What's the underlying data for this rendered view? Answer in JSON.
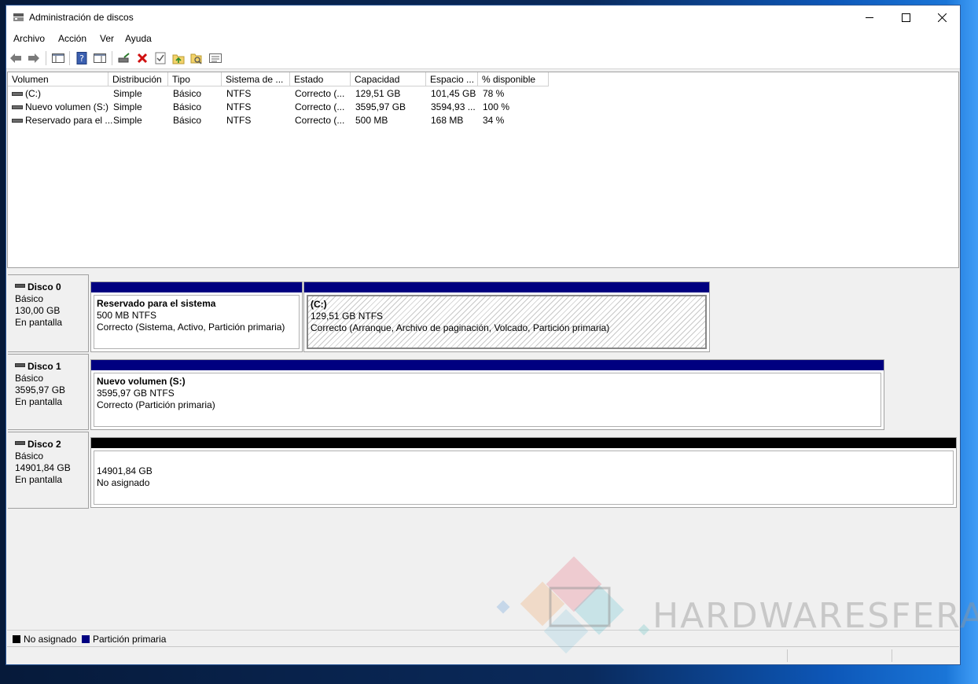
{
  "window": {
    "title": "Administración de discos"
  },
  "menu": {
    "items": [
      "Archivo",
      "Acción",
      "Ver",
      "Ayuda"
    ]
  },
  "volume_list": {
    "columns": [
      "Volumen",
      "Distribución",
      "Tipo",
      "Sistema de ...",
      "Estado",
      "Capacidad",
      "Espacio ...",
      "% disponible"
    ],
    "rows": [
      [
        "(C:)",
        "Simple",
        "Básico",
        "NTFS",
        "Correcto (...",
        "129,51 GB",
        "101,45 GB",
        "78 %"
      ],
      [
        "Nuevo volumen (S:)",
        "Simple",
        "Básico",
        "NTFS",
        "Correcto (...",
        "3595,97 GB",
        "3594,93 ...",
        "100 %"
      ],
      [
        "Reservado para el ...",
        "Simple",
        "Básico",
        "NTFS",
        "Correcto (...",
        "500 MB",
        "168 MB",
        "34 %"
      ]
    ]
  },
  "disks": [
    {
      "name": "Disco 0",
      "type": "Básico",
      "size": "130,00 GB",
      "status": "En pantalla",
      "partitions": [
        {
          "label": "Reservado para el sistema",
          "size": "500 MB NTFS",
          "status": "Correcto (Sistema, Activo, Partición primaria)"
        },
        {
          "label": "(C:)",
          "size": "129,51 GB NTFS",
          "status": "Correcto (Arranque, Archivo de paginación, Volcado, Partición primaria)"
        }
      ]
    },
    {
      "name": "Disco 1",
      "type": "Básico",
      "size": "3595,97 GB",
      "status": "En pantalla",
      "partitions": [
        {
          "label": "Nuevo volumen  (S:)",
          "size": "3595,97 GB NTFS",
          "status": "Correcto (Partición primaria)"
        }
      ]
    },
    {
      "name": "Disco 2",
      "type": "Básico",
      "size": "14901,84 GB",
      "status": "En pantalla",
      "partitions": [
        {
          "label": "",
          "size": "14901,84 GB",
          "status": "No asignado"
        }
      ]
    }
  ],
  "legend": {
    "items": [
      {
        "label": "No asignado",
        "color": "#000000"
      },
      {
        "label": "Partición primaria",
        "color": "#000080"
      }
    ]
  },
  "watermark": {
    "text": "HARDWARESFERA"
  },
  "colors": {
    "primary_partition": "#000080",
    "unallocated": "#000000"
  }
}
